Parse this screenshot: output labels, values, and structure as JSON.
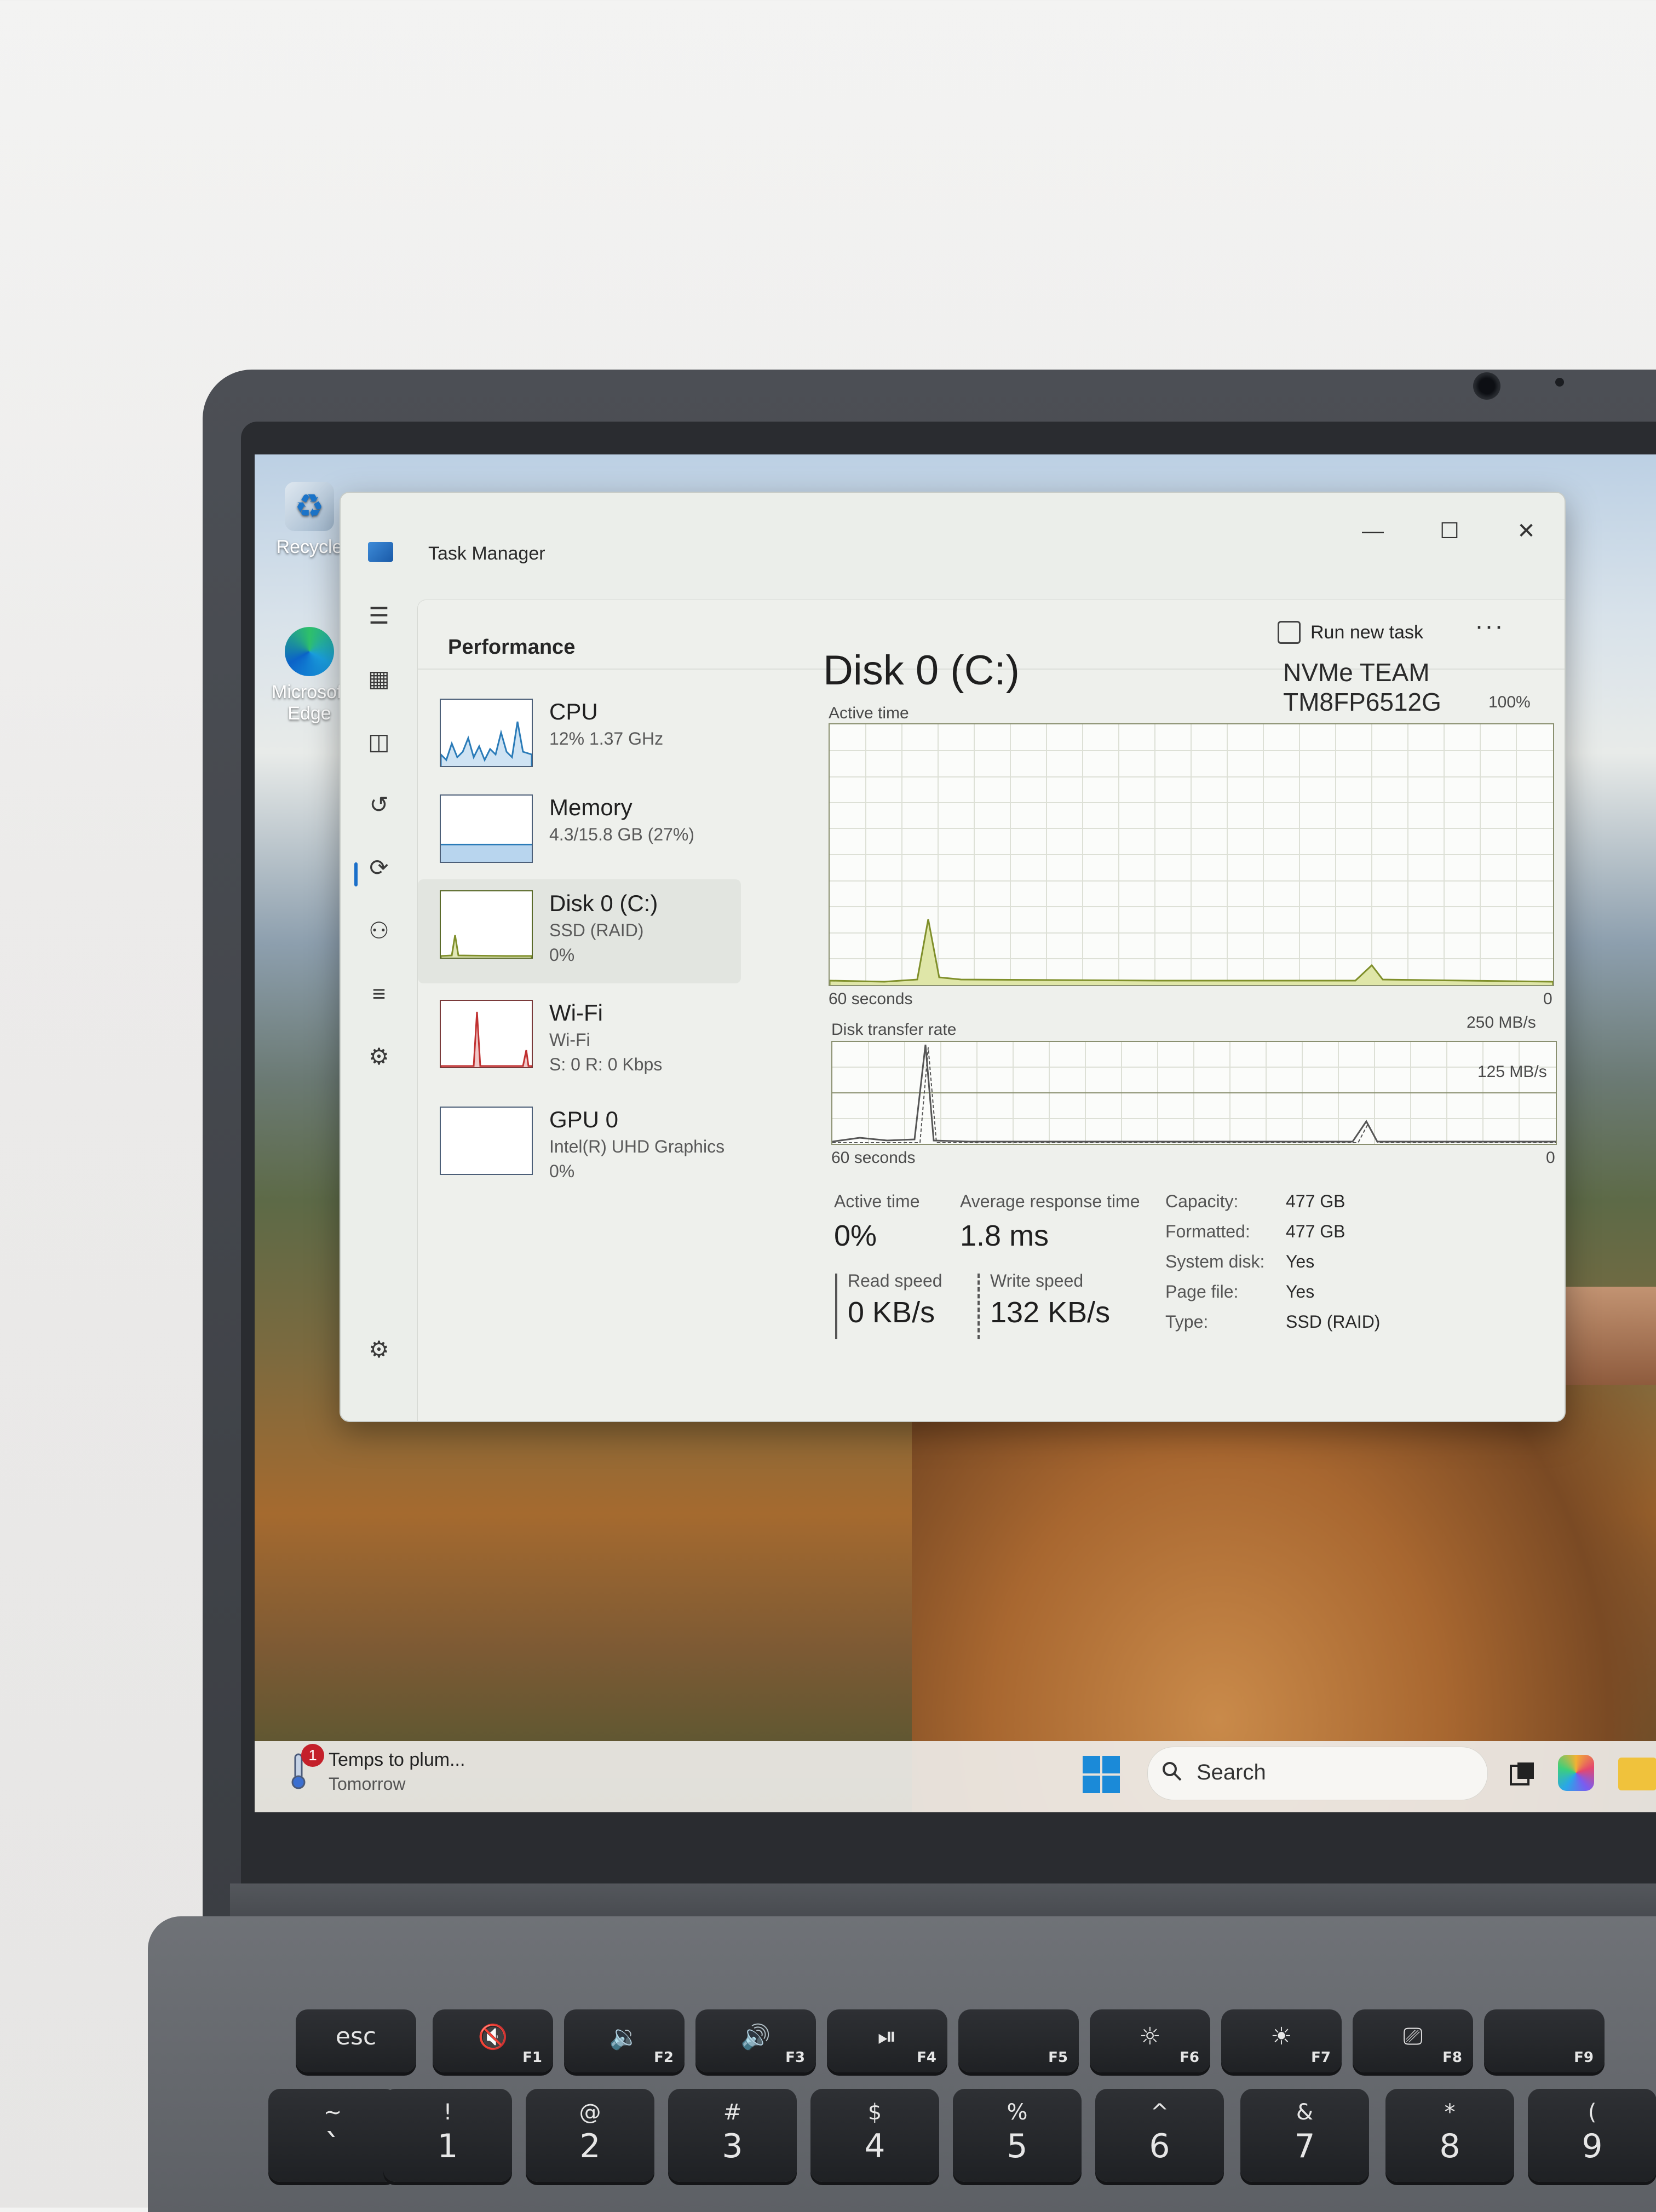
{
  "desktop": {
    "icons": [
      {
        "label": "Recycle"
      },
      {
        "label": "Microsoft Edge"
      }
    ]
  },
  "task_manager": {
    "window_title": "Task Manager",
    "window_controls": {
      "minimize": "—",
      "maximize": "☐",
      "close": "✕"
    },
    "nav_icons": [
      "hamburger-menu",
      "processes",
      "performance",
      "app-history",
      "startup-apps",
      "users",
      "details",
      "services",
      "settings"
    ],
    "page_title": "Performance",
    "run_new_task": "Run new task",
    "more_options": "···",
    "resources": [
      {
        "name": "CPU",
        "line1": "12% 1.37 GHz",
        "line2": ""
      },
      {
        "name": "Memory",
        "line1": "4.3/15.8 GB (27%)",
        "line2": ""
      },
      {
        "name": "Disk 0 (C:)",
        "line1": "SSD (RAID)",
        "line2": "0%"
      },
      {
        "name": "Wi-Fi",
        "line1": "Wi-Fi",
        "line2": "S: 0 R: 0 Kbps"
      },
      {
        "name": "GPU 0",
        "line1": "Intel(R) UHD Graphics",
        "line2": "0%"
      }
    ],
    "selected_resource": "Disk 0 (C:)",
    "detail": {
      "title": "Disk 0 (C:)",
      "model": "NVMe TEAM TM8FP6512G",
      "active_time_chart": {
        "label": "Active time",
        "max_label": "100%",
        "time_label": "60 seconds",
        "min_label": "0"
      },
      "transfer_chart": {
        "label": "Disk transfer rate",
        "max_label": "250 MB/s",
        "mid_label": "125 MB/s",
        "time_label": "60 seconds",
        "min_label": "0"
      },
      "stats": {
        "active_time_label": "Active time",
        "active_time_value": "0%",
        "avg_response_label": "Average response time",
        "avg_response_value": "1.8 ms",
        "read_speed_label": "Read speed",
        "read_speed_value": "0 KB/s",
        "write_speed_label": "Write speed",
        "write_speed_value": "132 KB/s"
      },
      "properties": [
        {
          "label": "Capacity:",
          "value": "477 GB"
        },
        {
          "label": "Formatted:",
          "value": "477 GB"
        },
        {
          "label": "System disk:",
          "value": "Yes"
        },
        {
          "label": "Page file:",
          "value": "Yes"
        },
        {
          "label": "Type:",
          "value": "SSD (RAID)"
        }
      ]
    }
  },
  "taskbar": {
    "weather_title": "Temps to plum...",
    "weather_sub": "Tomorrow",
    "notification_count": "1",
    "search_placeholder": "Search"
  },
  "keyboard": {
    "fn_row": [
      {
        "main": "esc",
        "fn": ""
      },
      {
        "main": "🔇",
        "fn": "F1"
      },
      {
        "main": "🔉",
        "fn": "F2"
      },
      {
        "main": "🔊",
        "fn": "F3"
      },
      {
        "main": "⏯",
        "fn": "F4"
      },
      {
        "main": "",
        "fn": "F5"
      },
      {
        "main": "☼",
        "fn": "F6"
      },
      {
        "main": "☀",
        "fn": "F7"
      },
      {
        "main": "⎚",
        "fn": "F8"
      },
      {
        "main": "",
        "fn": "F9"
      }
    ],
    "num_row": [
      {
        "top": "~",
        "main": "`"
      },
      {
        "top": "!",
        "main": "1"
      },
      {
        "top": "@",
        "main": "2"
      },
      {
        "top": "#",
        "main": "3"
      },
      {
        "top": "$",
        "main": "4"
      },
      {
        "top": "%",
        "main": "5"
      },
      {
        "top": "^",
        "main": "6"
      },
      {
        "top": "&",
        "main": "7"
      },
      {
        "top": "*",
        "main": "8"
      },
      {
        "top": "(",
        "main": "9"
      }
    ]
  },
  "colors": {
    "accent": "#1a6fc9",
    "disk_graph": "#7f8f2a",
    "cpu_graph": "#2a7bb8",
    "memory_graph": "#2a7bb8",
    "wifi_graph": "#c03030"
  }
}
